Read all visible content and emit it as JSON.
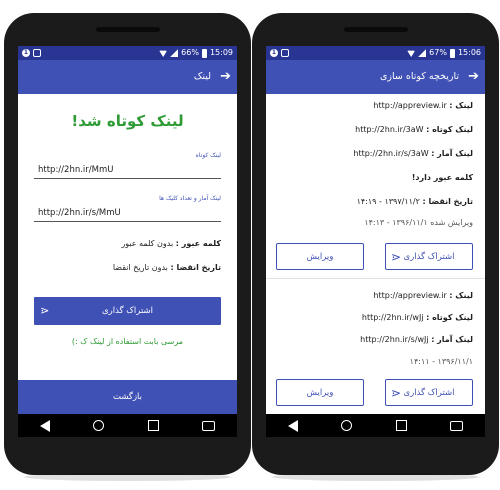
{
  "left": {
    "status": {
      "battery": "66%",
      "time": "15:09"
    },
    "appbar_title": "لینک",
    "heading": "لینک کوتاه شد!",
    "short_link_label": "لینک کوتاه",
    "short_link_value": "http://2hn.ir/MmU",
    "stats_link_label": "لینک آمار و تعداد کلیک ها",
    "stats_link_value": "http://2hn.ir/s/MmU",
    "password_key": "کلمه عبور :",
    "password_value": "بدون کلمه عبور",
    "expire_key": "تاریخ انقضا :",
    "expire_value": "بدون تاریخ انقضا",
    "share_label": "اشتراک گذاری",
    "thanks_text": "مرسی بابت استفاده از لینک ک :)",
    "return_label": "بازگشت"
  },
  "right": {
    "status": {
      "battery": "67%",
      "time": "15:06"
    },
    "appbar_title": "تاریخچه کوتاه سازی",
    "entries": [
      {
        "link_key": "لینک :",
        "link_value": "http://appreview.ir",
        "short_key": "لینک کوتاه :",
        "short_value": "http://2hn.ir/3aW",
        "stats_key": "لینک آمار :",
        "stats_value": "http://2hn.ir/s/3aW",
        "password_text": "کلمه عبور دارد!",
        "expire_key": "تاریخ انقضا :",
        "expire_value": "۱۳۹۷/۱۱/۲ - ۱۴:۱۹",
        "edited_text": "ویرایش شده ۱۳۹۶/۱۱/۱ - ۱۴:۱۳",
        "share_label": "اشتراک گذاری",
        "edit_label": "ویرایش"
      },
      {
        "link_key": "لینک :",
        "link_value": "http://appreview.ir",
        "short_key": "لینک کوتاه :",
        "short_value": "http://2hn.ir/wJj",
        "stats_key": "لینک آمار :",
        "stats_value": "http://2hn.ir/s/wJj",
        "date_text": "۱۳۹۶/۱۱/۱ - ۱۴:۱۱",
        "share_label": "اشتراک گذاری",
        "edit_label": "ویرایش"
      }
    ]
  },
  "colors": {
    "primary": "#3f51b5",
    "statusbar": "#283593",
    "success": "#2e9b36"
  }
}
